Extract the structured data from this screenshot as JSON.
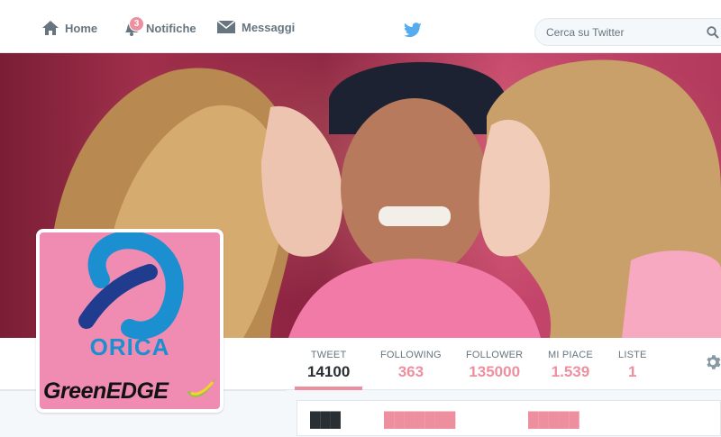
{
  "nav": {
    "home_label": "Home",
    "notifications_label": "Notifiche",
    "notifications_count": "3",
    "messages_label": "Messaggi"
  },
  "search": {
    "placeholder": "Cerca su Twitter"
  },
  "profile": {
    "avatar_text_top": "ORICA",
    "avatar_text_bottom": "GreenEDGE"
  },
  "stats": [
    {
      "label": "TWEET",
      "value": "14100"
    },
    {
      "label": "FOLLOWING",
      "value": "363"
    },
    {
      "label": "FOLLOWER",
      "value": "135000"
    },
    {
      "label": "MI PIACE",
      "value": "1.539"
    },
    {
      "label": "LISTE",
      "value": "1"
    }
  ],
  "colors": {
    "accent": "#ee8f9f",
    "twitter_blue": "#55acee",
    "text_gray": "#66757f"
  }
}
